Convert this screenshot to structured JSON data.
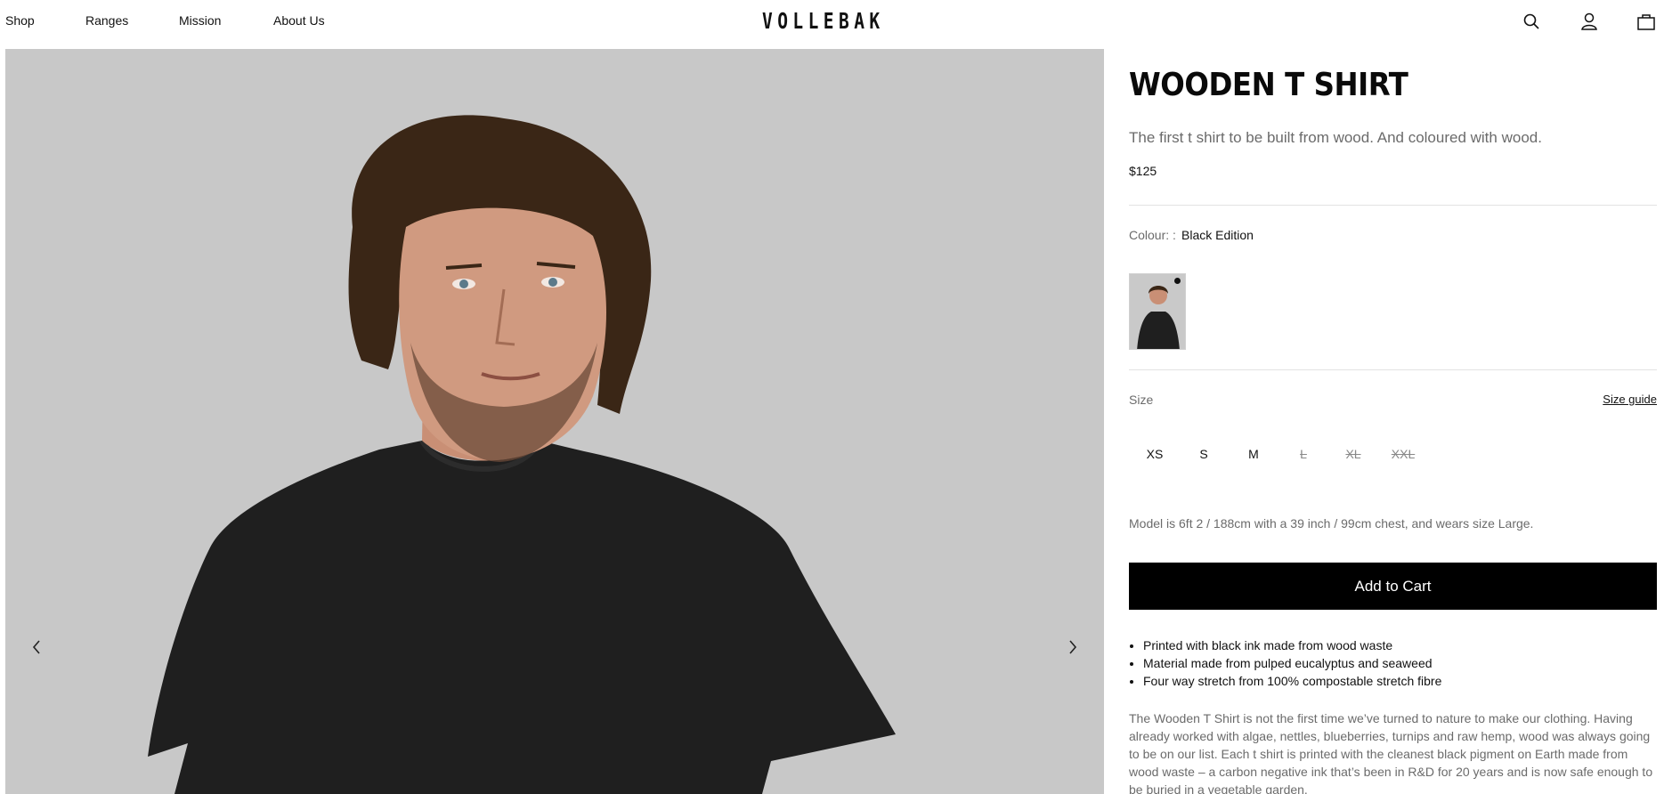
{
  "header": {
    "nav": [
      "Shop",
      "Ranges",
      "Mission",
      "About Us"
    ],
    "logo": "VOLLEBAK",
    "icons": [
      "search-icon",
      "account-icon",
      "bag-icon"
    ]
  },
  "gallery": {
    "prev_icon": "chevron-left-icon",
    "next_icon": "chevron-right-icon",
    "background": "#c8c8c8"
  },
  "product": {
    "title": "WOODEN T SHIRT",
    "subtitle": "The first t shirt to be built from wood. And coloured with wood.",
    "price": "$125",
    "colour_label": "Colour: :",
    "colour_value": "Black Edition",
    "size_label": "Size",
    "size_guide": "Size guide",
    "sizes": [
      {
        "label": "XS",
        "available": true
      },
      {
        "label": "S",
        "available": true
      },
      {
        "label": "M",
        "available": true
      },
      {
        "label": "L",
        "available": false
      },
      {
        "label": "XL",
        "available": false
      },
      {
        "label": "XXL",
        "available": false
      }
    ],
    "model_note": "Model is 6ft 2 / 188cm with a 39 inch / 99cm chest, and wears size Large.",
    "add_to_cart": "Add to Cart",
    "features": [
      "Printed with black ink made from wood waste",
      "Material made from pulped eucalyptus and seaweed",
      "Four way stretch from 100% compostable stretch fibre"
    ],
    "description": "The Wooden T Shirt is not the first time we’ve turned to nature to make our clothing. Having already worked with algae, nettles, blueberries, turnips and raw hemp, wood was always going to be on our list. Each t shirt is printed with the cleanest black pigment on Earth made from wood waste – a carbon negative ink that’s been in R&D for 20 years and is now safe enough to be buried in a vegetable garden."
  },
  "colors": {
    "accent": "#000000",
    "muted_text": "#6b6b6b",
    "divider": "#e3e3e3"
  }
}
